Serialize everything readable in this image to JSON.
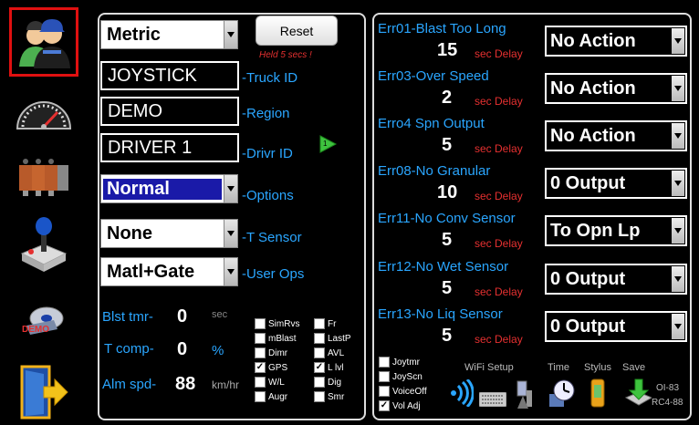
{
  "left": {
    "units_select": "Metric",
    "reset_label": "Reset",
    "reset_hint": "Held 5 secs !",
    "truck_id": "JOYSTICK",
    "truck_id_label": "-Truck ID",
    "region": "DEMO",
    "region_label": "-Region",
    "driver_id": "DRIVER 1",
    "driver_id_label": "-Drivr ID",
    "driver_badge": "1",
    "options_select": "Normal",
    "options_label": "-Options",
    "tsensor_select": "None",
    "tsensor_label": "-T Sensor",
    "userops_select": "Matl+Gate",
    "userops_label": "-User Ops",
    "blast_timer_label": "Blst tmr-",
    "blast_timer_value": "0",
    "blast_timer_unit": "sec",
    "tcomp_label": "T comp-",
    "tcomp_value": "0",
    "tcomp_unit": "%",
    "alarm_speed_label": "Alm spd-",
    "alarm_speed_value": "88",
    "alarm_speed_unit": "km/hr",
    "checks": [
      {
        "label": "SimRvs",
        "checked": false
      },
      {
        "label": "Fr",
        "checked": false
      },
      {
        "label": "mBlast",
        "checked": false
      },
      {
        "label": "LastP",
        "checked": false
      },
      {
        "label": "Dimr",
        "checked": false
      },
      {
        "label": "AVL",
        "checked": false
      },
      {
        "label": "GPS",
        "checked": true
      },
      {
        "label": "L lvl",
        "checked": true
      },
      {
        "label": "W/L",
        "checked": false
      },
      {
        "label": "Dig",
        "checked": false
      },
      {
        "label": "Augr",
        "checked": false
      },
      {
        "label": "Smr",
        "checked": false
      }
    ]
  },
  "errors": [
    {
      "label": "Err01-Blast Too Long",
      "delay": "15",
      "delay_unit": "sec Delay",
      "action": "No Action"
    },
    {
      "label": "Err03-Over Speed",
      "delay": "2",
      "delay_unit": "sec Delay",
      "action": "No Action"
    },
    {
      "label": "Erro4 Spn Output",
      "delay": "5",
      "delay_unit": "sec Delay",
      "action": "No Action"
    },
    {
      "label": "Err08-No Granular",
      "delay": "10",
      "delay_unit": "sec Delay",
      "action": "0 Output"
    },
    {
      "label": "Err11-No Conv Sensor",
      "delay": "5",
      "delay_unit": "sec Delay",
      "action": "To Opn Lp"
    },
    {
      "label": "Err12-No Wet Sensor",
      "delay": "5",
      "delay_unit": "sec Delay",
      "action": "0 Output"
    },
    {
      "label": "Err13-No Liq Sensor",
      "delay": "5",
      "delay_unit": "sec Delay",
      "action": "0 Output"
    }
  ],
  "bottom": {
    "checks": [
      {
        "label": "Joytmr",
        "checked": false
      },
      {
        "label": "JoyScn",
        "checked": false
      },
      {
        "label": "VoiceOff",
        "checked": false
      },
      {
        "label": "Vol Adj",
        "checked": true
      }
    ],
    "wifi_setup": "WiFi Setup",
    "time": "Time",
    "stylus": "Stylus",
    "save": "Save",
    "version1": "OI-83",
    "version2": "RC4-88"
  },
  "sidebar": {
    "demo_label": "DEMO"
  }
}
